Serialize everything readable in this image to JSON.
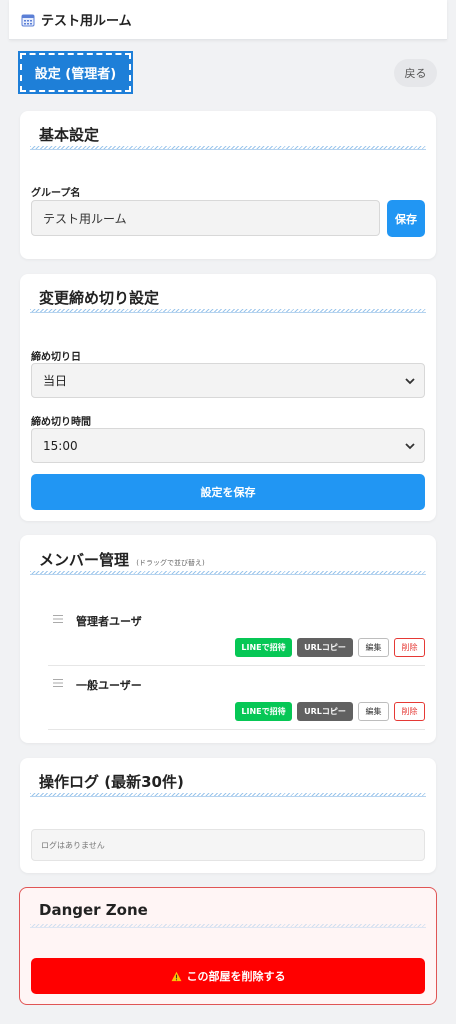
{
  "header": {
    "room_name": "テスト用ルーム",
    "icon": "calendar-icon"
  },
  "toolbar": {
    "settings_label": "設定 (管理者)",
    "back_label": "戻る"
  },
  "basic_settings": {
    "title": "基本設定",
    "group_name_label": "グループ名",
    "group_name_value": "テスト用ルーム",
    "save_label": "保存"
  },
  "deadline_settings": {
    "title": "変更締め切り設定",
    "day_label": "締め切り日",
    "day_value": "当日",
    "time_label": "締め切り時間",
    "time_value": "15:00",
    "save_label": "設定を保存"
  },
  "members": {
    "title": "メンバー管理",
    "subtitle": "(ドラッグで並び替え)",
    "items": [
      {
        "name": "管理者ユーザ",
        "line_invite": "LINEで招待",
        "url_copy": "URLコピー",
        "edit": "編集",
        "delete": "削除"
      },
      {
        "name": "一般ユーザー",
        "line_invite": "LINEで招待",
        "url_copy": "URLコピー",
        "edit": "編集",
        "delete": "削除"
      }
    ]
  },
  "logs": {
    "title": "操作ログ (最新30件)",
    "empty_text": "ログはありません"
  },
  "danger_zone": {
    "title": "Danger Zone",
    "delete_label": "この部屋を削除する",
    "icon": "warning-icon"
  },
  "colors": {
    "primary": "#2196f3",
    "line_green": "#06c755",
    "danger_red": "#ff0000",
    "url_gray": "#616161"
  }
}
